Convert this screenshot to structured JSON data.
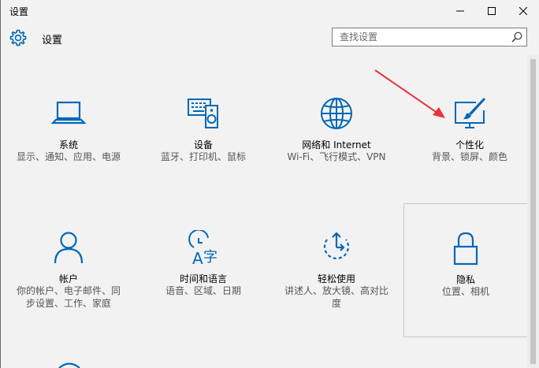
{
  "window": {
    "title": "设置",
    "controls": {
      "minimize": "minimize",
      "maximize": "maximize",
      "close": "close"
    }
  },
  "header": {
    "title": "设置",
    "search_placeholder": "查找设置"
  },
  "colors": {
    "accent": "#0067b8",
    "background": "#f2f2f2",
    "annotation_arrow": "#e8333a"
  },
  "tiles": [
    {
      "label": "系统",
      "desc": "显示、通知、应用、电源",
      "icon": "laptop-icon"
    },
    {
      "label": "设备",
      "desc": "蓝牙、打印机、鼠标",
      "icon": "devices-icon"
    },
    {
      "label": "网络和 Internet",
      "desc": "Wi-Fi、飞行模式、VPN",
      "icon": "globe-icon"
    },
    {
      "label": "个性化",
      "desc": "背景、锁屏、颜色",
      "icon": "personalization-icon"
    },
    {
      "label": "帐户",
      "desc": "你的帐户、电子邮件、同步设置、工作、家庭",
      "icon": "person-icon"
    },
    {
      "label": "时间和语言",
      "desc": "语音、区域、日期",
      "icon": "time-language-icon"
    },
    {
      "label": "轻松使用",
      "desc": "讲述人、放大镜、高对比度",
      "icon": "ease-of-access-icon"
    },
    {
      "label": "隐私",
      "desc": "位置、相机",
      "icon": "lock-icon"
    }
  ]
}
